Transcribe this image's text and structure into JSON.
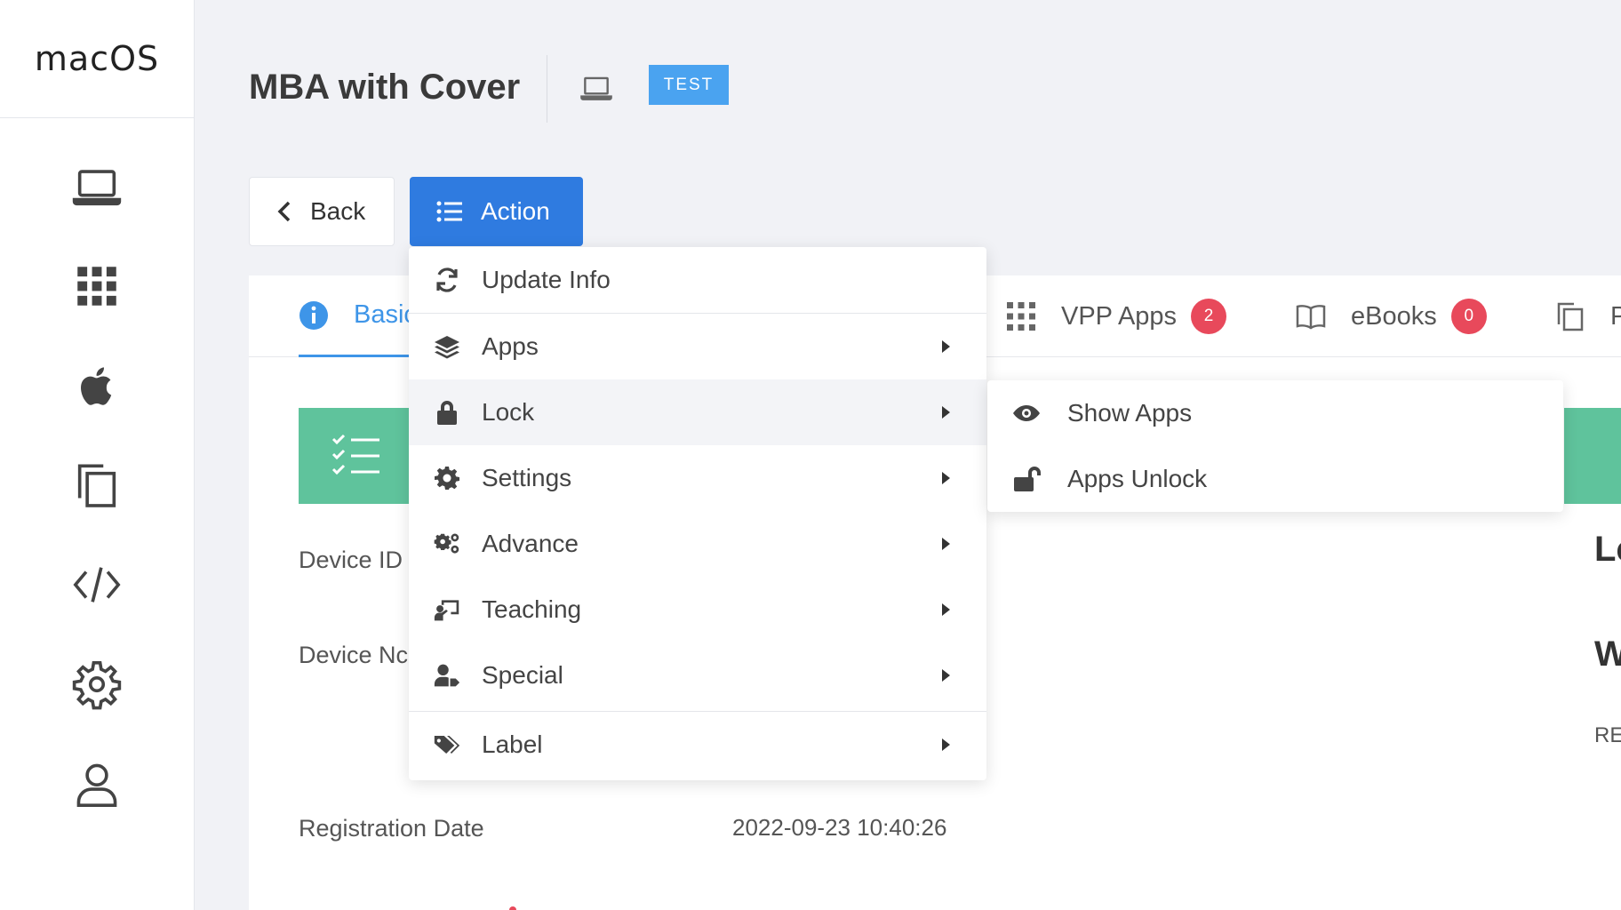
{
  "sidebar": {
    "brand": "macOS",
    "items": [
      {
        "icon": "laptop-icon"
      },
      {
        "icon": "apps-grid-icon"
      },
      {
        "icon": "apple-icon"
      },
      {
        "icon": "copy-icon"
      },
      {
        "icon": "code-icon"
      },
      {
        "icon": "gear-icon"
      },
      {
        "icon": "user-icon"
      }
    ]
  },
  "header": {
    "title": "MBA with Cover",
    "badge": "TEST",
    "badge_color": "#4aa3f0"
  },
  "toolbar": {
    "back_label": "Back",
    "action_label": "Action",
    "action_color": "#2f7be0"
  },
  "tabs": {
    "basic": "Basic",
    "vpp_apps": "VPP Apps",
    "vpp_apps_count": "2",
    "ebooks": "eBooks",
    "ebooks_count": "0",
    "next_partial": "P"
  },
  "fields": {
    "device_id_label": "Device ID",
    "device_name_label": "Device Nc",
    "registration_label": "Registration Date",
    "registration_value": "2022-09-23 10:40:26"
  },
  "right_partial": {
    "a": "Lc",
    "b": "W",
    "c": "RE"
  },
  "action_menu": {
    "items": [
      {
        "label": "Update Info",
        "icon": "refresh-icon"
      },
      {
        "label": "Apps",
        "icon": "layers-icon"
      },
      {
        "label": "Lock",
        "icon": "lock-icon"
      },
      {
        "label": "Settings",
        "icon": "gear-icon"
      },
      {
        "label": "Advance",
        "icon": "gears-icon"
      },
      {
        "label": "Teaching",
        "icon": "teacher-icon"
      },
      {
        "label": "Special",
        "icon": "user-tag-icon"
      },
      {
        "label": "Label",
        "icon": "tags-icon"
      }
    ]
  },
  "lock_submenu": {
    "items": [
      {
        "label": "Show Apps",
        "icon": "eye-icon"
      },
      {
        "label": "Apps Unlock",
        "icon": "unlock-icon"
      }
    ]
  },
  "colors": {
    "accent_green": "#5fc39c",
    "badge_red": "#e8495b",
    "tab_active": "#3e95e8"
  }
}
